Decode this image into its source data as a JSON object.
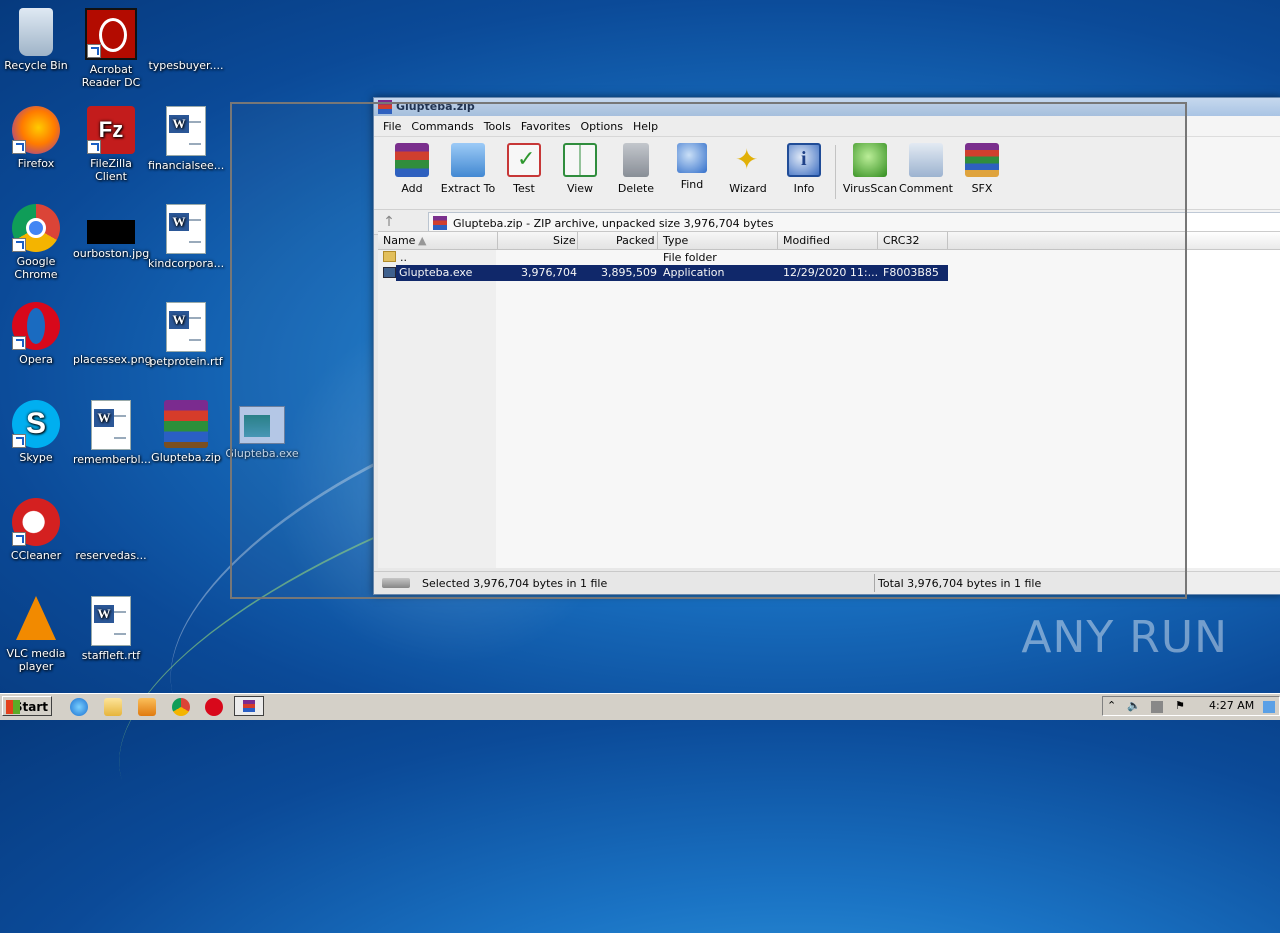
{
  "desktop": {
    "icons": [
      {
        "label": "Recycle Bin",
        "icon": "recycle-bin-icon"
      },
      {
        "label": "Acrobat Reader DC",
        "icon": "acrobat-icon"
      },
      {
        "label": "typesbuyer....",
        "icon": "file-icon"
      },
      {
        "label": "Firefox",
        "icon": "firefox-icon"
      },
      {
        "label": "FileZilla Client",
        "icon": "filezilla-icon"
      },
      {
        "label": "financialsee...",
        "icon": "word-doc-icon"
      },
      {
        "label": "Google Chrome",
        "icon": "chrome-icon"
      },
      {
        "label": "ourboston.jpg",
        "icon": "image-icon"
      },
      {
        "label": "kindcorpora...",
        "icon": "word-doc-icon"
      },
      {
        "label": "Opera",
        "icon": "opera-icon"
      },
      {
        "label": "placessex.png",
        "icon": "image-icon"
      },
      {
        "label": "petprotein.rtf",
        "icon": "word-doc-icon"
      },
      {
        "label": "Skype",
        "icon": "skype-icon"
      },
      {
        "label": "rememberbl...",
        "icon": "word-doc-icon"
      },
      {
        "label": "Glupteba.zip",
        "icon": "winrar-archive-icon"
      },
      {
        "label": "Glupteba.exe",
        "icon": "exe-icon"
      },
      {
        "label": "CCleaner",
        "icon": "ccleaner-icon"
      },
      {
        "label": "reservedas...",
        "icon": "file-icon"
      },
      {
        "label": "VLC media player",
        "icon": "vlc-icon"
      },
      {
        "label": "staffleft.rtf",
        "icon": "word-doc-icon"
      }
    ]
  },
  "window": {
    "title": "Glupteba.zip",
    "menu": [
      "File",
      "Commands",
      "Tools",
      "Favorites",
      "Options",
      "Help"
    ],
    "toolbar": [
      "Add",
      "Extract To",
      "Test",
      "View",
      "Delete",
      "Find",
      "Wizard",
      "Info",
      "VirusScan",
      "Comment",
      "SFX"
    ],
    "address": "Glupteba.zip - ZIP archive, unpacked size 3,976,704 bytes",
    "columns": [
      "Name",
      "Size",
      "Packed",
      "Type",
      "Modified",
      "CRC32"
    ],
    "rows": [
      {
        "name": "..",
        "size": "",
        "packed": "",
        "type": "File folder",
        "modified": "",
        "crc": ""
      },
      {
        "name": "Glupteba.exe",
        "size": "3,976,704",
        "packed": "3,895,509",
        "type": "Application",
        "modified": "12/29/2020 11:...",
        "crc": "F8003B85"
      }
    ],
    "status_left": "Selected 3,976,704 bytes in 1 file",
    "status_right": "Total 3,976,704 bytes in 1 file"
  },
  "watermark": "ANY RUN",
  "taskbar": {
    "start": "Start",
    "time": "4:27 AM"
  }
}
